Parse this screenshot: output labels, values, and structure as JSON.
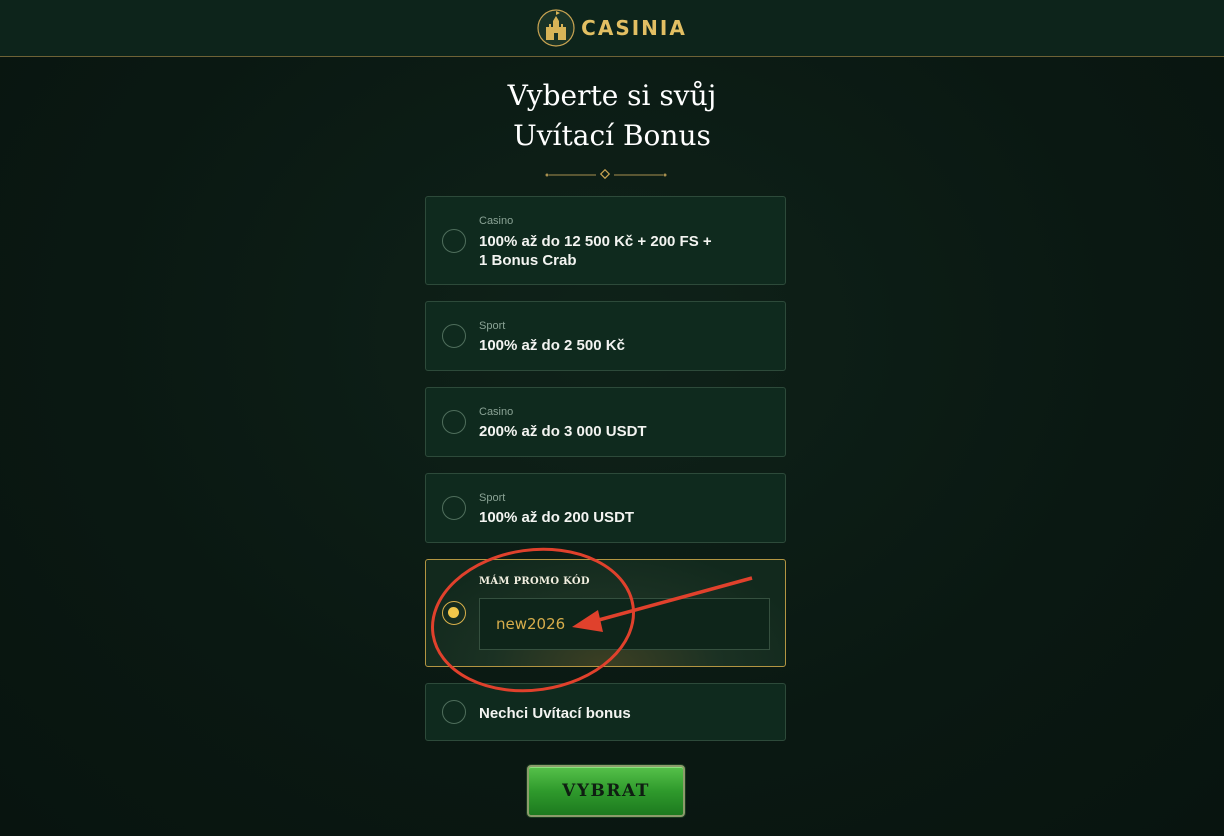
{
  "brand": {
    "name": "CASINIA"
  },
  "heading": {
    "line1": "Vyberte si svůj",
    "line2": "Uvítací Bonus"
  },
  "options": [
    {
      "category": "Casino",
      "title_line1": "100% až do 12 500 Kč + 200 FS +",
      "title_line2": "1 Bonus Crab",
      "selected": false
    },
    {
      "category": "Sport",
      "title_line1": "100% až do 2 500 Kč",
      "selected": false
    },
    {
      "category": "Casino",
      "title_line1": "200% až do 3 000 USDT",
      "selected": false
    },
    {
      "category": "Sport",
      "title_line1": "100% až do 200 USDT",
      "selected": false
    }
  ],
  "promo": {
    "label": "MÁM PROMO KÓD",
    "value": "new2026",
    "selected": true
  },
  "no_bonus": {
    "label": "Nechci Uvítací bonus",
    "selected": false
  },
  "submit": {
    "label": "VYBRAT"
  },
  "colors": {
    "accent_gold": "#e2bf63",
    "annotation_red": "#e0412c",
    "button_green": "#2f9a2c"
  }
}
